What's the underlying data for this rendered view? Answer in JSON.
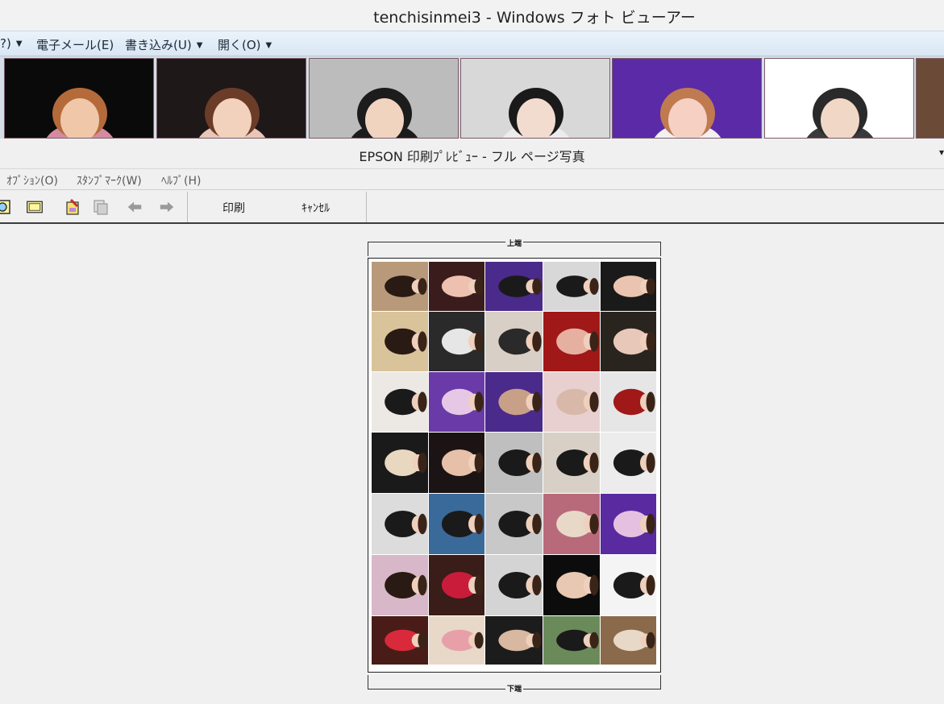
{
  "photo_viewer": {
    "title": "tenchisinmei3 - Windows フォト ビューアー",
    "menu": [
      {
        "label": "?)",
        "has_arrow": true
      },
      {
        "label": "電子メール(E)",
        "has_arrow": false
      },
      {
        "label": "書き込み(U)",
        "has_arrow": true
      },
      {
        "label": "開く(O)",
        "has_arrow": true
      }
    ]
  },
  "thumbnails": [
    {
      "bg": "#0a0a0a",
      "fg": "#f0c7a8",
      "hair": "#b56a3a",
      "top": "#d58aa0"
    },
    {
      "bg": "#1e1818",
      "fg": "#f3d2bd",
      "hair": "#6b3d28",
      "top": "#e8c6b8"
    },
    {
      "bg": "#bcbcbc",
      "fg": "#f0d4c0",
      "hair": "#1c1c1c",
      "top": "#1c1c1c"
    },
    {
      "bg": "#d8d8d8",
      "fg": "#f2dccf",
      "hair": "#1a1a1a",
      "top": "#ececec"
    },
    {
      "bg": "#5b2aa6",
      "fg": "#f6d0c2",
      "hair": "#c07a50",
      "top": "#f2f0f0"
    },
    {
      "bg": "#ffffff",
      "fg": "#f1d7c6",
      "hair": "#2a2a2a",
      "top": "#3a3a3a"
    },
    {
      "bg": "#6b4a38",
      "fg": "#f3d3bf",
      "hair": "#5b3a28",
      "top": "#f0e0d0"
    }
  ],
  "epson": {
    "title": "EPSON 印刷ﾌﾟﾚﾋﾞｭｰ - フル ページ写真",
    "menu": [
      "ｵﾌﾟｼｮﾝ(O)",
      "ｽﾀﾝﾌﾟﾏｰｸ(W)",
      "ﾍﾙﾌﾟ(H)"
    ],
    "print_label": "印刷",
    "cancel_label": "ｷｬﾝｾﾙ",
    "top_label": "上端",
    "bottom_label": "下端"
  },
  "print_grid": {
    "rows": [
      [
        "#b89a7a",
        "#3a1c1c",
        "#4a2a8a",
        "#d8d8d8",
        "#1a1a1a"
      ],
      [
        "#d9c39a",
        "#2a2a2a",
        "#d8cfc6",
        "#a01818",
        "#2a241e"
      ],
      [
        "#ece8e4",
        "#6a3aa8",
        "#4a2a8a",
        "#e8d0d0",
        "#e6e6e6"
      ],
      [
        "#1a1a1a",
        "#1c1414",
        "#bfbfbf",
        "#d8d0c6",
        "#ececec"
      ],
      [
        "#dcdcdc",
        "#3a6a9a",
        "#c8c8c8",
        "#b86a7a",
        "#5a2aa0"
      ],
      [
        "#d8b8c8",
        "#3a1c18",
        "#d4d4d4",
        "#0c0c0c",
        "#f4f4f4"
      ],
      [
        "#4a1c18",
        "#e8d8c8",
        "#1c1c1c",
        "#6a8a5a",
        "#8a6a4a"
      ]
    ],
    "figure_tones": [
      [
        "#2a1a14",
        "#eec0b0",
        "#1a1a1a",
        "#1a1a1a",
        "#eac4b0"
      ],
      [
        "#2a1a14",
        "#e6e6e6",
        "#2a2a2a",
        "#e6b0a0",
        "#e8c8b8"
      ],
      [
        "#1a1a1a",
        "#e6c8e6",
        "#c8a088",
        "#d8b8a8",
        "#a01818"
      ],
      [
        "#e8d8c0",
        "#e6c0a8",
        "#1a1a1a",
        "#1a1a1a",
        "#1a1a1a"
      ],
      [
        "#1a1a1a",
        "#1a1a1a",
        "#1a1a1a",
        "#e8d8c8",
        "#e6c0e0"
      ],
      [
        "#2a1a14",
        "#c81c3a",
        "#1a1a1a",
        "#e8c8b0",
        "#1a1a1a"
      ],
      [
        "#d82a3a",
        "#e8a0a8",
        "#d8b8a0",
        "#1a1a1a",
        "#e8d8c8"
      ]
    ]
  }
}
